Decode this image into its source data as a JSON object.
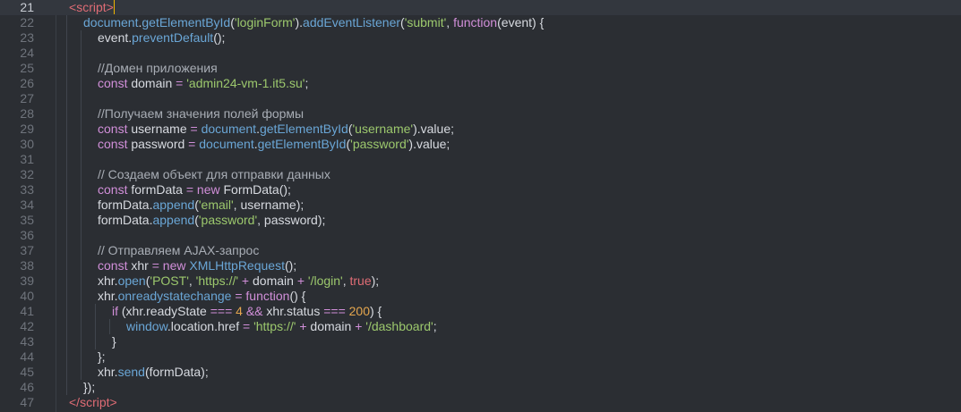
{
  "editor": {
    "active_line": "21",
    "lines": [
      {
        "num": "21",
        "indent": 0,
        "tokens": [
          [
            "t-tag",
            "<"
          ],
          [
            "t-tag",
            "script"
          ],
          [
            "t-tag",
            ">"
          ]
        ],
        "caret": true
      },
      {
        "num": "22",
        "indent": 1,
        "tokens": [
          [
            "t-fn",
            "document"
          ],
          [
            "t-plain",
            "."
          ],
          [
            "t-fn",
            "getElementById"
          ],
          [
            "t-plain",
            "("
          ],
          [
            "t-str",
            "'loginForm'"
          ],
          [
            "t-plain",
            ")."
          ],
          [
            "t-fn",
            "addEventListener"
          ],
          [
            "t-plain",
            "("
          ],
          [
            "t-str",
            "'submit'"
          ],
          [
            "t-plain",
            ", "
          ],
          [
            "t-kw",
            "function"
          ],
          [
            "t-plain",
            "("
          ],
          [
            "t-plain",
            "event"
          ],
          [
            "t-plain",
            ") {"
          ]
        ]
      },
      {
        "num": "23",
        "indent": 2,
        "tokens": [
          [
            "t-plain",
            "event."
          ],
          [
            "t-fn",
            "preventDefault"
          ],
          [
            "t-plain",
            "();"
          ]
        ]
      },
      {
        "num": "24",
        "indent": 2,
        "tokens": []
      },
      {
        "num": "25",
        "indent": 2,
        "tokens": [
          [
            "t-cmt",
            "//Домен приложения"
          ]
        ]
      },
      {
        "num": "26",
        "indent": 2,
        "tokens": [
          [
            "t-kw",
            "const"
          ],
          [
            "t-plain",
            " domain "
          ],
          [
            "t-op",
            "="
          ],
          [
            "t-plain",
            " "
          ],
          [
            "t-str",
            "'admin24-vm-1.it5.su'"
          ],
          [
            "t-plain",
            ";"
          ]
        ]
      },
      {
        "num": "27",
        "indent": 2,
        "tokens": []
      },
      {
        "num": "28",
        "indent": 2,
        "tokens": [
          [
            "t-cmt",
            "//Получаем значения полей формы"
          ]
        ]
      },
      {
        "num": "29",
        "indent": 2,
        "tokens": [
          [
            "t-kw",
            "const"
          ],
          [
            "t-plain",
            " username "
          ],
          [
            "t-op",
            "="
          ],
          [
            "t-plain",
            " "
          ],
          [
            "t-fn",
            "document"
          ],
          [
            "t-plain",
            "."
          ],
          [
            "t-fn",
            "getElementById"
          ],
          [
            "t-plain",
            "("
          ],
          [
            "t-str",
            "'username'"
          ],
          [
            "t-plain",
            ").value;"
          ]
        ]
      },
      {
        "num": "30",
        "indent": 2,
        "tokens": [
          [
            "t-kw",
            "const"
          ],
          [
            "t-plain",
            " password "
          ],
          [
            "t-op",
            "="
          ],
          [
            "t-plain",
            " "
          ],
          [
            "t-fn",
            "document"
          ],
          [
            "t-plain",
            "."
          ],
          [
            "t-fn",
            "getElementById"
          ],
          [
            "t-plain",
            "("
          ],
          [
            "t-str",
            "'password'"
          ],
          [
            "t-plain",
            ").value;"
          ]
        ]
      },
      {
        "num": "31",
        "indent": 2,
        "tokens": []
      },
      {
        "num": "32",
        "indent": 2,
        "tokens": [
          [
            "t-cmt",
            "// Создаем объект для отправки данных"
          ]
        ]
      },
      {
        "num": "33",
        "indent": 2,
        "tokens": [
          [
            "t-kw",
            "const"
          ],
          [
            "t-plain",
            " formData "
          ],
          [
            "t-op",
            "="
          ],
          [
            "t-plain",
            " "
          ],
          [
            "t-kw",
            "new"
          ],
          [
            "t-plain",
            " FormData();"
          ]
        ]
      },
      {
        "num": "34",
        "indent": 2,
        "tokens": [
          [
            "t-plain",
            "formData."
          ],
          [
            "t-fn",
            "append"
          ],
          [
            "t-plain",
            "("
          ],
          [
            "t-str",
            "'email'"
          ],
          [
            "t-plain",
            ", username);"
          ]
        ]
      },
      {
        "num": "35",
        "indent": 2,
        "tokens": [
          [
            "t-plain",
            "formData."
          ],
          [
            "t-fn",
            "append"
          ],
          [
            "t-plain",
            "("
          ],
          [
            "t-str",
            "'password'"
          ],
          [
            "t-plain",
            ", password);"
          ]
        ]
      },
      {
        "num": "36",
        "indent": 2,
        "tokens": []
      },
      {
        "num": "37",
        "indent": 2,
        "tokens": [
          [
            "t-cmt",
            "// Отправляем AJAX-запрос"
          ]
        ]
      },
      {
        "num": "38",
        "indent": 2,
        "tokens": [
          [
            "t-kw",
            "const"
          ],
          [
            "t-plain",
            " xhr "
          ],
          [
            "t-op",
            "="
          ],
          [
            "t-plain",
            " "
          ],
          [
            "t-kw",
            "new"
          ],
          [
            "t-plain",
            " "
          ],
          [
            "t-fn",
            "XMLHttpRequest"
          ],
          [
            "t-plain",
            "();"
          ]
        ]
      },
      {
        "num": "39",
        "indent": 2,
        "tokens": [
          [
            "t-plain",
            "xhr."
          ],
          [
            "t-fn",
            "open"
          ],
          [
            "t-plain",
            "("
          ],
          [
            "t-str",
            "'POST'"
          ],
          [
            "t-plain",
            ", "
          ],
          [
            "t-str",
            "'https://'"
          ],
          [
            "t-plain",
            " "
          ],
          [
            "t-op",
            "+"
          ],
          [
            "t-plain",
            " domain "
          ],
          [
            "t-op",
            "+"
          ],
          [
            "t-plain",
            " "
          ],
          [
            "t-str",
            "'/login'"
          ],
          [
            "t-plain",
            ", "
          ],
          [
            "t-bool",
            "true"
          ],
          [
            "t-plain",
            ");"
          ]
        ]
      },
      {
        "num": "40",
        "indent": 2,
        "tokens": [
          [
            "t-plain",
            "xhr."
          ],
          [
            "t-fn",
            "onreadystatechange"
          ],
          [
            "t-plain",
            " "
          ],
          [
            "t-op",
            "="
          ],
          [
            "t-plain",
            " "
          ],
          [
            "t-kw",
            "function"
          ],
          [
            "t-plain",
            "() {"
          ]
        ]
      },
      {
        "num": "41",
        "indent": 3,
        "tokens": [
          [
            "t-kw",
            "if"
          ],
          [
            "t-plain",
            " (xhr.readyState "
          ],
          [
            "t-op",
            "==="
          ],
          [
            "t-plain",
            " "
          ],
          [
            "t-num",
            "4"
          ],
          [
            "t-plain",
            " "
          ],
          [
            "t-op",
            "&&"
          ],
          [
            "t-plain",
            " xhr.status "
          ],
          [
            "t-op",
            "==="
          ],
          [
            "t-plain",
            " "
          ],
          [
            "t-num",
            "200"
          ],
          [
            "t-plain",
            ") {"
          ]
        ]
      },
      {
        "num": "42",
        "indent": 4,
        "tokens": [
          [
            "t-fn",
            "window"
          ],
          [
            "t-plain",
            ".location.href "
          ],
          [
            "t-op",
            "="
          ],
          [
            "t-plain",
            " "
          ],
          [
            "t-str",
            "'https://'"
          ],
          [
            "t-plain",
            " "
          ],
          [
            "t-op",
            "+"
          ],
          [
            "t-plain",
            " domain "
          ],
          [
            "t-op",
            "+"
          ],
          [
            "t-plain",
            " "
          ],
          [
            "t-str",
            "'/dashboard'"
          ],
          [
            "t-plain",
            ";"
          ]
        ]
      },
      {
        "num": "43",
        "indent": 3,
        "tokens": [
          [
            "t-plain",
            "}"
          ]
        ]
      },
      {
        "num": "44",
        "indent": 2,
        "tokens": [
          [
            "t-plain",
            "};"
          ]
        ]
      },
      {
        "num": "45",
        "indent": 2,
        "tokens": [
          [
            "t-plain",
            "xhr."
          ],
          [
            "t-fn",
            "send"
          ],
          [
            "t-plain",
            "(formData);"
          ]
        ]
      },
      {
        "num": "46",
        "indent": 1,
        "tokens": [
          [
            "t-plain",
            "});"
          ]
        ]
      },
      {
        "num": "47",
        "indent": 0,
        "tokens": [
          [
            "t-tag",
            "</"
          ],
          [
            "t-tag",
            "script"
          ],
          [
            "t-tag",
            ">"
          ]
        ]
      }
    ]
  },
  "colors": {
    "background": "#2b2e33",
    "active_line": "#33373e",
    "caret": "#f0b400",
    "keyword": "#d18fd9",
    "string": "#9cc86d",
    "function": "#6aa6d6",
    "number": "#e5a64e",
    "tag": "#e06c75"
  }
}
